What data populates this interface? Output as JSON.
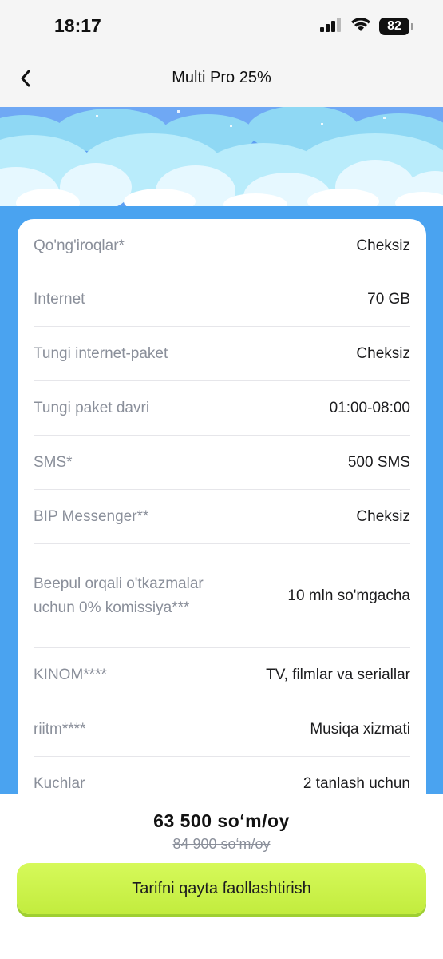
{
  "status_bar": {
    "time": "18:17",
    "battery": "82"
  },
  "header": {
    "title": "Multi Pro 25%"
  },
  "features": [
    {
      "label": "Qo'ng'iroqlar*",
      "value": "Cheksiz"
    },
    {
      "label": "Internet",
      "value": "70 GB"
    },
    {
      "label": "Tungi internet-paket",
      "value": "Cheksiz"
    },
    {
      "label": "Tungi paket davri",
      "value": "01:00-08:00"
    },
    {
      "label": "SMS*",
      "value": "500 SMS"
    },
    {
      "label": "BIP Messenger**",
      "value": "Cheksiz"
    },
    {
      "label": "Beepul orqali o'tkazmalar uchun 0% komissiya***",
      "value": "10 mln so'mgacha"
    },
    {
      "label": "KINOM****",
      "value": "TV, filmlar va seriallar"
    },
    {
      "label": "riitm****",
      "value": "Musiqa xizmati"
    },
    {
      "label": "Kuchlar",
      "value": "2 tanlash uchun"
    }
  ],
  "pricing": {
    "price": "63 500  so‘m/oy",
    "old_price": "84 900  so‘m/oy"
  },
  "cta": {
    "label": "Tarifni qayta faollashtirish"
  },
  "colors": {
    "accent_blue": "#4aa3f0",
    "button_green": "#c9f04a"
  }
}
